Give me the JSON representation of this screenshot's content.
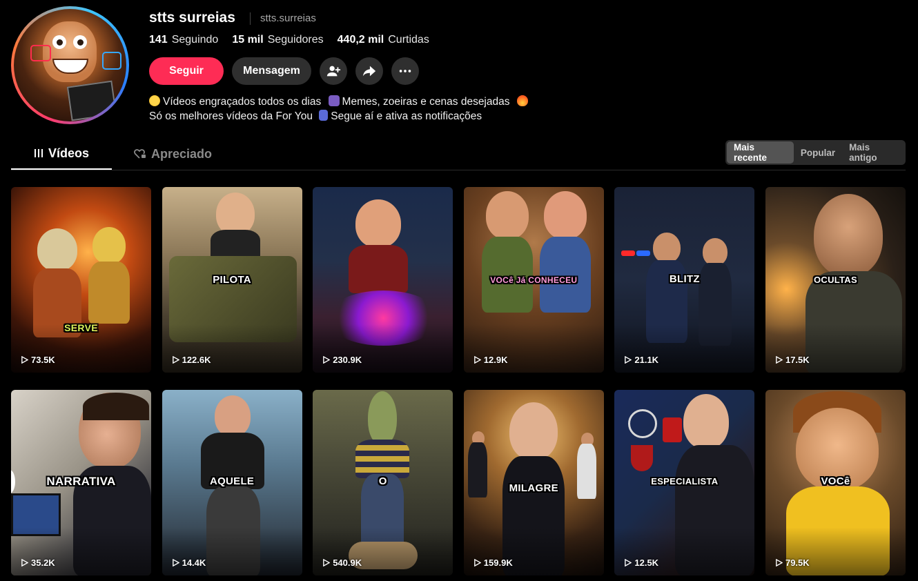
{
  "profile": {
    "name": "stts surreias",
    "handle": "stts.surreias",
    "stats": [
      {
        "value": "141",
        "label": "Seguindo"
      },
      {
        "value": "15 mil",
        "label": "Seguidores"
      },
      {
        "value": "440,2 mil",
        "label": "Curtidas"
      }
    ],
    "bio_line1": "Vídeos engraçados todos os dias",
    "bio_line1b": "Memes, zoeiras e cenas desejadas",
    "bio_line2": "Só os melhores vídeos da For You",
    "bio_line2b": "Segue aí e ativa as notificações"
  },
  "actions": {
    "follow_label": "Seguir",
    "message_label": "Mensagem",
    "add_friend_icon": "person-add-icon",
    "share_icon": "share-arrow-icon",
    "more_icon": "more-dots-icon"
  },
  "tabs": [
    {
      "label": "Vídeos",
      "icon": "grid-icon",
      "active": true
    },
    {
      "label": "Apreciado",
      "icon": "heart-lock-icon",
      "active": false
    }
  ],
  "sort": {
    "options": [
      "Mais recente",
      "Popular",
      "Mais antigo"
    ],
    "selected": "Mais recente"
  },
  "videos": [
    {
      "caption": "SERVE",
      "views": "73.5K"
    },
    {
      "caption": "PILOTA",
      "views": "122.6K"
    },
    {
      "caption": "",
      "views": "230.9K"
    },
    {
      "caption": "VOCê Já CONHECEU",
      "views": "12.9K"
    },
    {
      "caption": "BLITZ",
      "views": "21.1K"
    },
    {
      "caption": "OCULTAS",
      "views": "17.5K"
    },
    {
      "caption": "NARRATIVA",
      "views": "35.2K"
    },
    {
      "caption": "AQUELE",
      "views": "14.4K"
    },
    {
      "caption": "O",
      "views": "540.9K"
    },
    {
      "caption": "MILAGRE",
      "views": "159.9K"
    },
    {
      "caption": "ESPECIALISTA",
      "views": "12.5K"
    },
    {
      "caption": "VOCê",
      "views": "79.5K"
    }
  ],
  "colors": {
    "accent": "#fe2c55",
    "background": "#000000",
    "button_secondary": "#2f2f2f"
  }
}
